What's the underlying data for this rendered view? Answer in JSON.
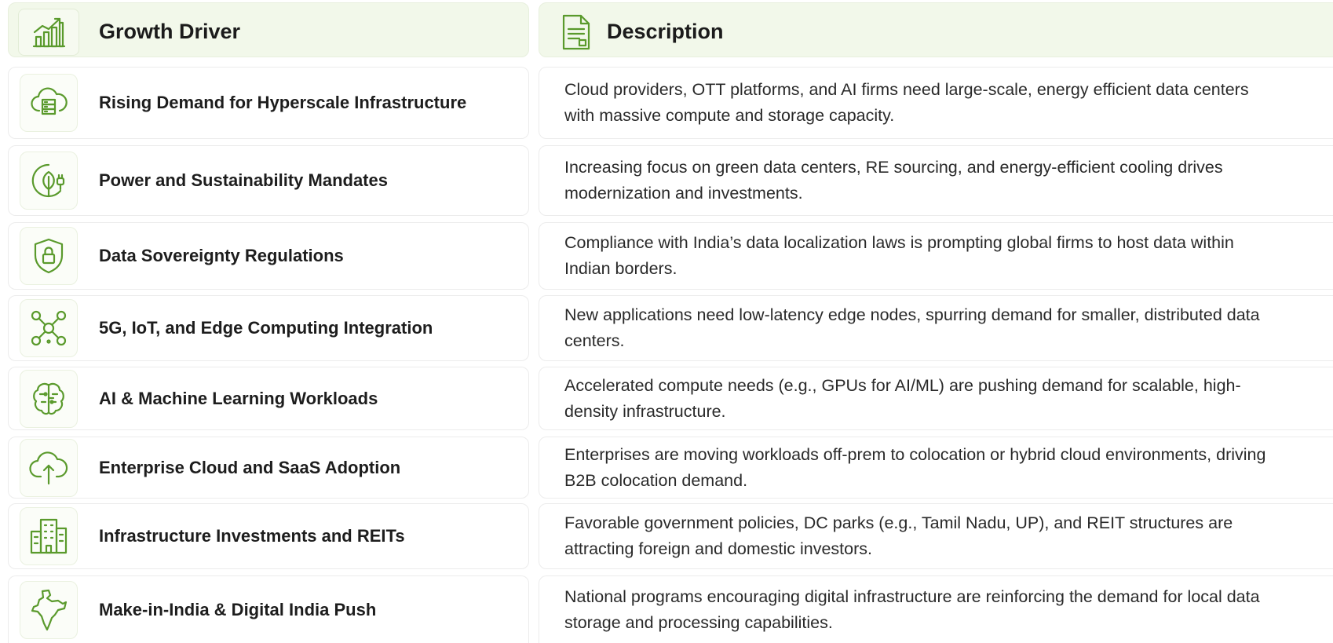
{
  "header": {
    "driver_label": "Growth Driver",
    "description_label": "Description",
    "driver_icon": "bar-chart-growth-icon",
    "description_icon": "document-icon"
  },
  "rows": [
    {
      "title": "Rising Demand for Hyperscale Infrastructure",
      "icon": "cloud-server-icon",
      "description": "Cloud providers, OTT platforms, and AI firms need large-scale, energy efficient data centers with massive compute and storage capacity."
    },
    {
      "title": "Power and Sustainability Mandates",
      "icon": "leaf-plug-icon",
      "description": "Increasing focus on green data centers, RE sourcing, and energy-efficient cooling drives modernization and investments."
    },
    {
      "title": "Data Sovereignty Regulations",
      "icon": "shield-lock-icon",
      "description": "Compliance with India’s data localization laws is prompting global firms to host data within Indian borders."
    },
    {
      "title": "5G, IoT, and Edge Computing Integration",
      "icon": "network-nodes-icon",
      "description": "New applications need low-latency edge nodes, spurring demand for smaller, distributed data centers."
    },
    {
      "title": "AI & Machine Learning Workloads",
      "icon": "brain-circuit-icon",
      "description": "Accelerated compute needs (e.g., GPUs for AI/ML) are pushing demand for scalable, high-density infrastructure."
    },
    {
      "title": "Enterprise Cloud and SaaS Adoption",
      "icon": "cloud-upload-icon",
      "description": "Enterprises are moving workloads off-prem to colocation or hybrid cloud environments, driving B2B colocation demand."
    },
    {
      "title": "Infrastructure Investments and REITs",
      "icon": "buildings-icon",
      "description": "Favorable government policies, DC parks (e.g., Tamil Nadu, UP), and REIT structures are attracting foreign and domestic investors."
    },
    {
      "title": "Make-in-India & Digital India Push",
      "icon": "india-map-icon",
      "description": "National programs encouraging digital infrastructure are reinforcing the demand for local data storage and processing capabilities."
    }
  ],
  "colors": {
    "accent": "#5a9a2c",
    "header_bg": "#f2f8ea",
    "border": "#ececec"
  }
}
